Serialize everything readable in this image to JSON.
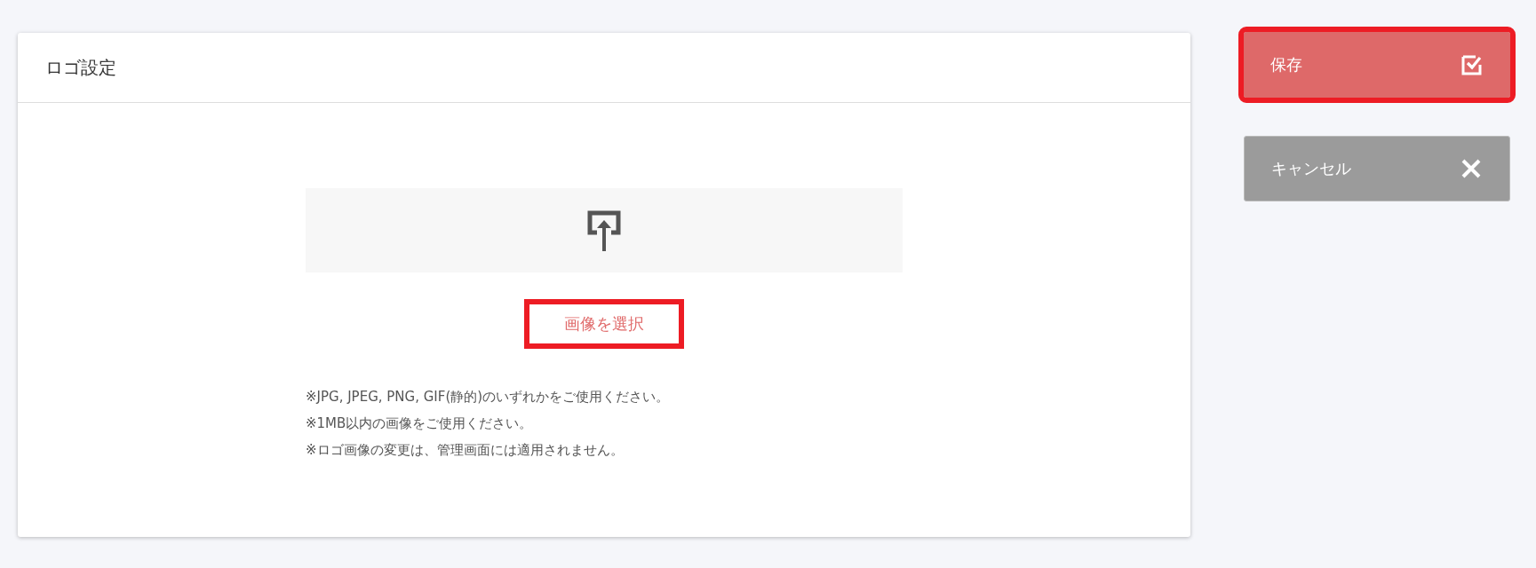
{
  "card": {
    "title": "ロゴ設定",
    "upload": {
      "select_button": {
        "label": "画像を選択",
        "highlighted": true
      }
    },
    "notes": [
      "※JPG, JPEG, PNG, GIF(静的)のいずれかをご使用ください。",
      "※1MB以内の画像をご使用ください。",
      "※ロゴ画像の変更は、管理画面には適用されません。"
    ]
  },
  "actions": [
    {
      "kind": "save",
      "label": "保存",
      "highlighted": true
    },
    {
      "kind": "cancel",
      "label": "キャンセル",
      "highlighted": false
    }
  ]
}
